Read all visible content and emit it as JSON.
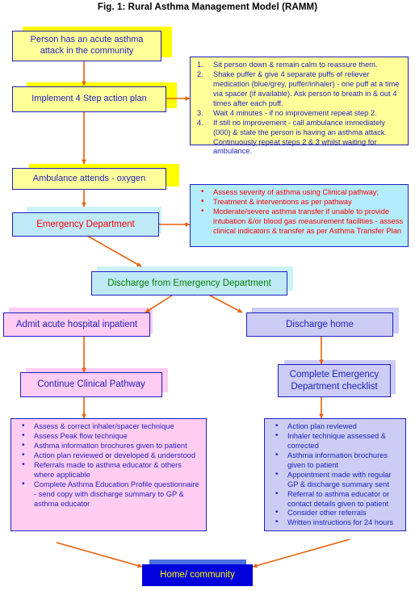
{
  "figure": {
    "title": "Fig. 1: Rural Asthma Management Model (RAMM)"
  },
  "colors": {
    "border": "#1f1fbf",
    "arrow": "#e8620c",
    "yellow_fill": "#ffff99",
    "yellow_shadow": "#ffff00",
    "cyan_fill": "#bfe9f7",
    "pink_fill": "#ffccf2",
    "lavender_fill": "#ccccf5",
    "deep_blue_fill": "#0000dd",
    "red_text": "#ff0000",
    "green_text": "#008000",
    "yellow_text": "#ffff00",
    "blue_text": "#1f1fbf"
  },
  "nodes": {
    "acute_attack": "Person has an acute asthma attack in the community",
    "four_step": "Implement 4 Step action plan",
    "ambulance": "Ambulance attends - oxygen",
    "emergency_dept": "Emergency Department",
    "discharge_ed": "Discharge from Emergency Department",
    "admit_inpatient": "Admit acute hospital inpatient",
    "discharge_home": "Discharge home",
    "continue_pathway": "Continue Clinical Pathway",
    "complete_checklist": "Complete Emergency Department checklist",
    "home_community": "Home/ community"
  },
  "action_plan": {
    "items": [
      {
        "num": "1.",
        "text": "Sit person down & remain calm to reassure them."
      },
      {
        "num": "2.",
        "text": "Shake puffer & give 4 separate puffs of reliever medication (blue/grey, puffer/inhaler) - one puff at a time via spacer (if available). Ask person to breath in & out 4 times after each puff."
      },
      {
        "num": "3.",
        "text": "Wait 4 minutes - if no improvement repeat step 2."
      },
      {
        "num": "4.",
        "text": "If still no improvement - call ambulance immediately (000) & state the person is having an asthma attack. Continuously repeat steps 2 & 3 whilst waiting for ambulance."
      }
    ]
  },
  "ed_actions": {
    "items": [
      "Assess severity of asthma using Clinical pathway;",
      "Treatment & interventions as per pathway",
      "Moderate/severe asthma transfer if unable to provide intubation &/or blood gas measurement facilities - assess clinical indicators & transfer as per Asthma Transfer Plan"
    ]
  },
  "inpatient_actions": {
    "items": [
      "Assess & correct inhaler/spacer technique",
      "Assess Peak flow technique",
      "Asthma information brochures given to patient",
      "Action plan reviewed or developed & understood",
      "Referrals made to asthma educator & others where applicable",
      "Complete Asthma Education Profile questionnaire - send copy with discharge summary to GP & asthma educator"
    ]
  },
  "discharge_actions": {
    "items": [
      "Action plan reviewed",
      "Inhaler technique assessed & corrected",
      "Asthma information brochures given to patient",
      "Appointment made with regular GP & discharge summary sent",
      "Referral to asthma educator or contact details given to patient",
      "Consider other referrals",
      "Written instructions for 24 hours"
    ]
  }
}
